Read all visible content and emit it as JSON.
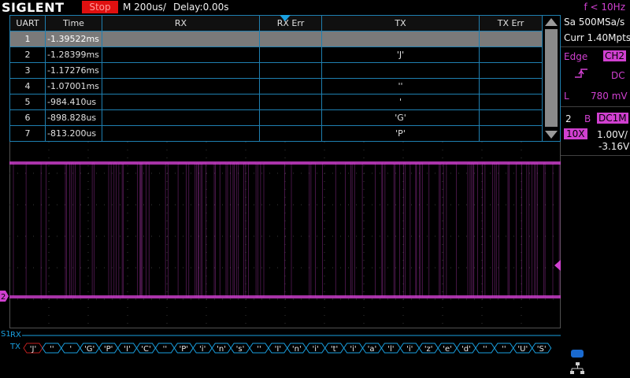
{
  "top": {
    "logo": "SIGLENT",
    "run_state": "Stop",
    "timebase": "M 200us/",
    "delay": "Delay:0.00s",
    "trigger_freq": "f < 10Hz"
  },
  "acq": {
    "sample_rate": "Sa 500MSa/s",
    "memory": "Curr 1.40Mpts"
  },
  "trigger": {
    "type": "Edge",
    "source": "CH2",
    "coupling": "DC",
    "level_label": "L",
    "level": "780 mV"
  },
  "channel": {
    "number": "2",
    "bw": "B",
    "coupling": "DC1M",
    "probe": "10X",
    "scale": "1.00V/",
    "offset": "-3.16V"
  },
  "table": {
    "headers": [
      "UART",
      "Time",
      "RX",
      "RX Err",
      "TX",
      "TX Err"
    ],
    "rows": [
      {
        "idx": "1",
        "time": "-1.39522ms",
        "rx": "",
        "rxerr": "",
        "tx": "",
        "txerr": ""
      },
      {
        "idx": "2",
        "time": "-1.28399ms",
        "rx": "",
        "rxerr": "",
        "tx": "'J'",
        "txerr": ""
      },
      {
        "idx": "3",
        "time": "-1.17276ms",
        "rx": "",
        "rxerr": "",
        "tx": "",
        "txerr": ""
      },
      {
        "idx": "4",
        "time": "-1.07001ms",
        "rx": "",
        "rxerr": "",
        "tx": "''",
        "txerr": ""
      },
      {
        "idx": "5",
        "time": "-984.410us",
        "rx": "",
        "rxerr": "",
        "tx": "'",
        "txerr": ""
      },
      {
        "idx": "6",
        "time": "-898.828us",
        "rx": "",
        "rxerr": "",
        "tx": "'G'",
        "txerr": ""
      },
      {
        "idx": "7",
        "time": "-813.200us",
        "rx": "",
        "rxerr": "",
        "tx": "'P'",
        "txerr": ""
      }
    ]
  },
  "bus": {
    "s1_label": "S1",
    "rx_label": "RX",
    "tx_label": "TX",
    "tx_symbols": [
      "'J'",
      "''",
      "'",
      "'G'",
      "'P'",
      "'I'",
      "'C'",
      "''",
      "'P'",
      "'i'",
      "'n'",
      "'s'",
      "''",
      "'I'",
      "'n'",
      "'i'",
      "'t'",
      "'i'",
      "'a'",
      "'l'",
      "'i'",
      "'z'",
      "'e'",
      "'d'",
      "''",
      "''",
      "'U'",
      "'S'"
    ]
  },
  "colors": {
    "channel": "#d040d0",
    "decode": "#1aa0e0",
    "stop": "#e01010",
    "grid": "#505050"
  }
}
